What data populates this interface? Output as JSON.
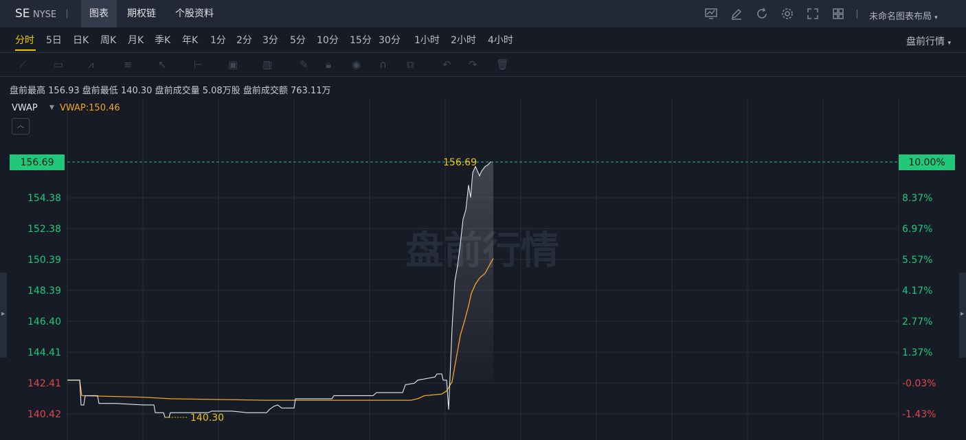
{
  "header": {
    "symbol": "SE",
    "exchange": "NYSE",
    "tabs": [
      "图表",
      "期权链",
      "个股资料"
    ],
    "active_tab": "图表",
    "layout_label": "未命名图表布局",
    "icons": [
      "screen-chart-icon",
      "edit-icon",
      "refresh-icon",
      "settings-icon",
      "fullscreen-icon",
      "grid-layout-icon"
    ]
  },
  "periods": {
    "items": [
      "分时",
      "5日",
      "日K",
      "周K",
      "月K",
      "季K",
      "年K",
      "1分",
      "2分",
      "3分",
      "5分",
      "10分",
      "15分",
      "30分",
      "1小时",
      "2小时",
      "4小时"
    ],
    "active": "分时",
    "session_label": "盘前行情"
  },
  "drawing_tools": [
    "line-tool-icon",
    "rect-tool-icon",
    "wave-tool-icon",
    "fib-tool-icon",
    "arrow-tool-icon",
    "measure-tool-icon",
    "text-tool-icon",
    "bar-tool-icon",
    "pen-icon",
    "lock-icon",
    "eye-icon",
    "magnet-icon",
    "copy-icon",
    "undo-icon",
    "redo-icon",
    "trash-icon"
  ],
  "stats": {
    "high_label": "盘前最高",
    "high": "156.93",
    "low_label": "盘前最低",
    "low": "140.30",
    "vol_label": "盘前成交量",
    "vol": "5.08万股",
    "amt_label": "盘前成交额",
    "amt": "763.11万"
  },
  "indicator": {
    "name": "VWAP",
    "value_text": "VWAP:150.46"
  },
  "watermark": "盘前行情",
  "colors": {
    "up": "#21c87a",
    "down": "#e0474c",
    "price_line": "#e6e8ec",
    "vwap_line": "#f5a623",
    "highlight": "#f1c40f",
    "background": "#161b26"
  },
  "chart_data": {
    "type": "line",
    "y_axis_left": [
      "142.41",
      "140.42"
    ],
    "y_axis_left_up": [
      "154.38",
      "152.38",
      "150.39",
      "148.39",
      "146.40",
      "144.41"
    ],
    "y_axis_right_up": [
      "8.37%",
      "6.97%",
      "5.57%",
      "4.17%",
      "2.77%",
      "1.37%"
    ],
    "y_axis_right_down": [
      "-0.03%",
      "-1.43%"
    ],
    "current_price_tag": "156.69",
    "current_pct_tag": "10.00%",
    "high_marker": "156.69",
    "low_marker": "140.30",
    "ylim": [
      139.7,
      158.0
    ],
    "series": [
      {
        "values": [
          [
            0,
            142.6
          ],
          [
            18,
            142.6
          ],
          [
            20,
            141.0
          ],
          [
            24,
            141.0
          ],
          [
            26,
            141.6
          ],
          [
            44,
            141.6
          ],
          [
            46,
            141.1
          ],
          [
            70,
            141.1
          ],
          [
            110,
            141.0
          ],
          [
            126,
            141.0
          ],
          [
            128,
            140.5
          ],
          [
            140,
            140.5
          ],
          [
            142,
            140.2
          ],
          [
            148,
            140.2
          ],
          [
            150,
            140.5
          ],
          [
            205,
            140.5
          ],
          [
            210,
            140.6
          ],
          [
            240,
            140.6
          ],
          [
            262,
            140.5
          ],
          [
            290,
            140.5
          ],
          [
            294,
            140.7
          ],
          [
            300,
            140.9
          ],
          [
            306,
            141.0
          ],
          [
            312,
            140.8
          ],
          [
            330,
            140.8
          ],
          [
            332,
            141.4
          ],
          [
            365,
            141.4
          ],
          [
            385,
            141.4
          ],
          [
            388,
            141.6
          ],
          [
            445,
            141.6
          ],
          [
            450,
            141.8
          ],
          [
            488,
            141.8
          ],
          [
            492,
            142.3
          ],
          [
            505,
            142.4
          ],
          [
            510,
            142.6
          ],
          [
            535,
            142.8
          ],
          [
            538,
            143.0
          ],
          [
            545,
            143.0
          ],
          [
            547,
            142.6
          ],
          [
            552,
            142.6
          ],
          [
            555,
            140.7
          ],
          [
            560,
            146.0
          ],
          [
            564,
            149.0
          ],
          [
            568,
            150.0
          ],
          [
            572,
            151.4
          ],
          [
            576,
            153.0
          ],
          [
            580,
            153.6
          ],
          [
            584,
            155.2
          ],
          [
            587,
            154.4
          ],
          [
            590,
            156.0
          ],
          [
            594,
            156.4
          ],
          [
            600,
            155.8
          ],
          [
            603,
            156.1
          ],
          [
            608,
            156.4
          ],
          [
            612,
            156.5
          ],
          [
            616,
            156.7
          ],
          [
            620,
            156.69
          ]
        ]
      },
      {
        "values": [
          [
            0,
            142.6
          ],
          [
            18,
            142.6
          ],
          [
            21,
            141.6
          ],
          [
            110,
            141.5
          ],
          [
            150,
            141.4
          ],
          [
            290,
            141.3
          ],
          [
            500,
            141.3
          ],
          [
            510,
            141.4
          ],
          [
            520,
            141.6
          ],
          [
            545,
            141.7
          ],
          [
            552,
            141.9
          ],
          [
            560,
            142.5
          ],
          [
            564,
            143.5
          ],
          [
            568,
            144.5
          ],
          [
            572,
            145.5
          ],
          [
            578,
            146.4
          ],
          [
            584,
            147.4
          ],
          [
            588,
            148.2
          ],
          [
            594,
            148.8
          ],
          [
            600,
            149.2
          ],
          [
            608,
            149.5
          ],
          [
            614,
            150.0
          ],
          [
            620,
            150.46
          ]
        ]
      }
    ]
  }
}
